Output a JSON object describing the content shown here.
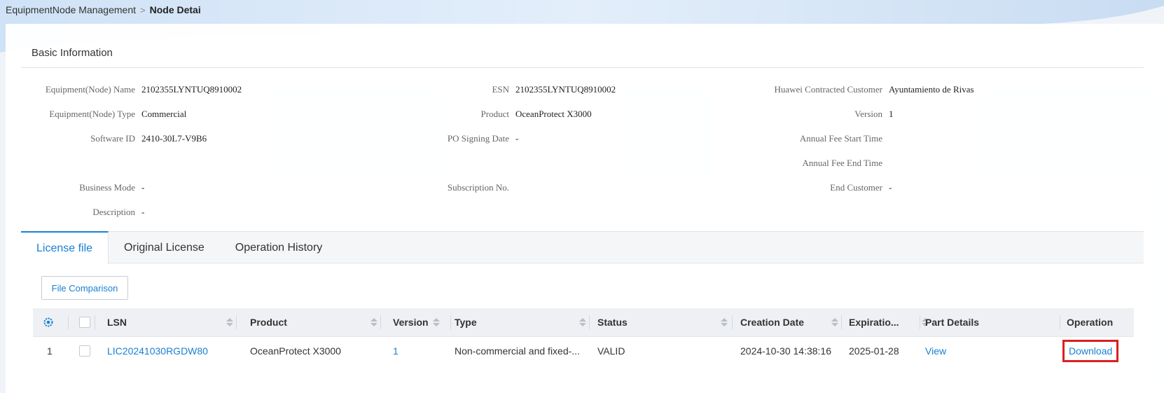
{
  "breadcrumb": {
    "parent": "EquipmentNode Management",
    "separator": ">",
    "current": "Node Detai"
  },
  "basic_info": {
    "title": "Basic Information",
    "fields": {
      "equipment_name": {
        "label": "Equipment(Node) Name",
        "value": "2102355LYNTUQ8910002"
      },
      "esn": {
        "label": "ESN",
        "value": "2102355LYNTUQ8910002"
      },
      "contracted_customer": {
        "label": "Huawei Contracted Customer",
        "value": "Ayuntamiento de Rivas"
      },
      "equipment_type": {
        "label": "Equipment(Node) Type",
        "value": "Commercial"
      },
      "product": {
        "label": "Product",
        "value": "OceanProtect X3000"
      },
      "version": {
        "label": "Version",
        "value": "1"
      },
      "software_id": {
        "label": "Software ID",
        "value": "2410-30L7-V9B6"
      },
      "po_signing_date": {
        "label": "PO Signing Date",
        "value": "-"
      },
      "annual_fee_start": {
        "label": "Annual Fee Start Time",
        "value": ""
      },
      "annual_fee_end": {
        "label": "Annual Fee End Time",
        "value": ""
      },
      "business_mode": {
        "label": "Business Mode",
        "value": "-"
      },
      "subscription_no": {
        "label": "Subscription No.",
        "value": ""
      },
      "end_customer": {
        "label": "End Customer",
        "value": "-"
      },
      "description": {
        "label": "Description",
        "value": "-"
      }
    }
  },
  "tabs": [
    {
      "label": "License file",
      "active": true
    },
    {
      "label": "Original License",
      "active": false
    },
    {
      "label": "Operation History",
      "active": false
    }
  ],
  "toolbar": {
    "compare_label": "File Comparison"
  },
  "table": {
    "headers": {
      "lsn": "LSN",
      "product": "Product",
      "version": "Version",
      "type": "Type",
      "status": "Status",
      "creation_date": "Creation Date",
      "expiration": "Expiratio...",
      "part_details": "Part Details",
      "operation": "Operation"
    },
    "rows": [
      {
        "index": "1",
        "lsn": "LIC20241030RGDW80",
        "product": "OceanProtect X3000",
        "version": "1",
        "type": "Non-commercial and fixed-...",
        "status": "VALID",
        "creation_date": "2024-10-30 14:38:16",
        "expiration": "2025-01-28",
        "part_details": "View",
        "operation": "Download"
      }
    ]
  },
  "colors": {
    "accent": "#1a7fd4",
    "highlight_box": "#d9201f",
    "header_bg": "#eef0f3"
  }
}
